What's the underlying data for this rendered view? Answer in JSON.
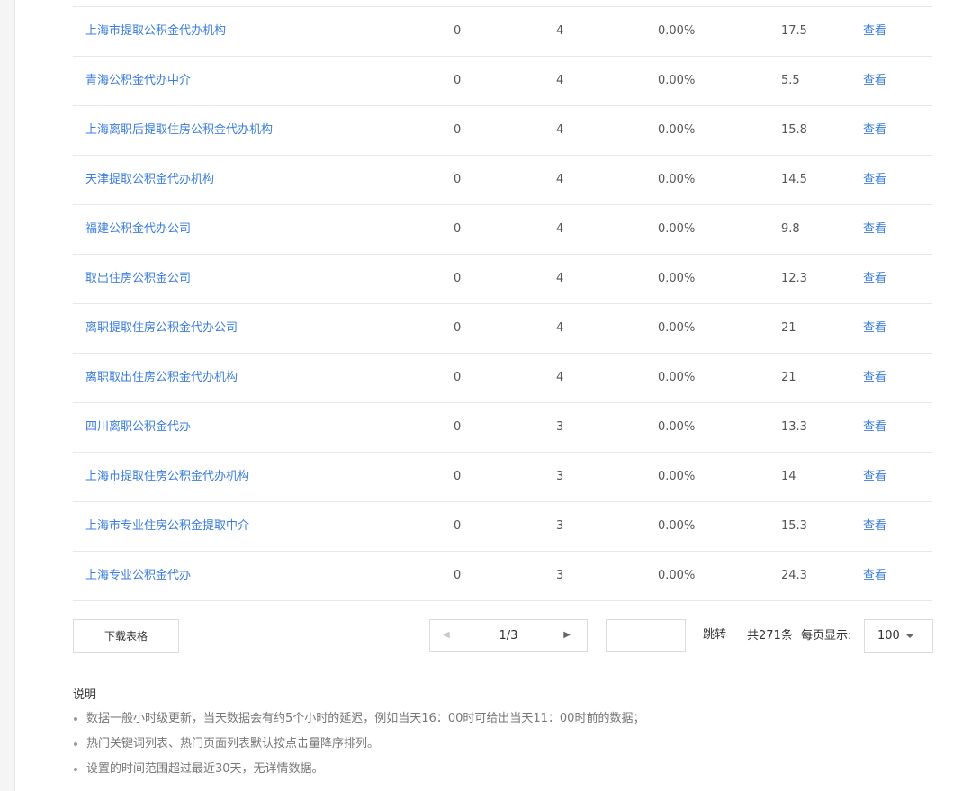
{
  "table": {
    "rows": [
      {
        "name": "上海市提取公积金代办机构",
        "a": "0",
        "b": "4",
        "c": "0.00%",
        "d": "17.5",
        "action": "查看"
      },
      {
        "name": "青海公积金代办中介",
        "a": "0",
        "b": "4",
        "c": "0.00%",
        "d": "5.5",
        "action": "查看"
      },
      {
        "name": "上海离职后提取住房公积金代办机构",
        "a": "0",
        "b": "4",
        "c": "0.00%",
        "d": "15.8",
        "action": "查看"
      },
      {
        "name": "天津提取公积金代办机构",
        "a": "0",
        "b": "4",
        "c": "0.00%",
        "d": "14.5",
        "action": "查看"
      },
      {
        "name": "福建公积金代办公司",
        "a": "0",
        "b": "4",
        "c": "0.00%",
        "d": "9.8",
        "action": "查看"
      },
      {
        "name": "取出住房公积金公司",
        "a": "0",
        "b": "4",
        "c": "0.00%",
        "d": "12.3",
        "action": "查看"
      },
      {
        "name": "离职提取住房公积金代办公司",
        "a": "0",
        "b": "4",
        "c": "0.00%",
        "d": "21",
        "action": "查看"
      },
      {
        "name": "离职取出住房公积金代办机构",
        "a": "0",
        "b": "4",
        "c": "0.00%",
        "d": "21",
        "action": "查看"
      },
      {
        "name": "四川离职公积金代办",
        "a": "0",
        "b": "3",
        "c": "0.00%",
        "d": "13.3",
        "action": "查看"
      },
      {
        "name": "上海市提取住房公积金代办机构",
        "a": "0",
        "b": "3",
        "c": "0.00%",
        "d": "14",
        "action": "查看"
      },
      {
        "name": "上海市专业住房公积金提取中介",
        "a": "0",
        "b": "3",
        "c": "0.00%",
        "d": "15.3",
        "action": "查看"
      },
      {
        "name": "上海专业公积金代办",
        "a": "0",
        "b": "3",
        "c": "0.00%",
        "d": "24.3",
        "action": "查看"
      }
    ]
  },
  "footer": {
    "download_label": "下载表格",
    "page_indicator": "1/3",
    "jump_input_value": "",
    "jump_label": "跳转",
    "total_label": "共271条",
    "per_page_label": "每页显示:",
    "per_page_value": "100"
  },
  "notes": {
    "title": "说明",
    "items": [
      "数据一般小时级更新，当天数据会有约5个小时的延迟，例如当天16：00时可给出当天11：00时前的数据；",
      "热门关键词列表、热门页面列表默认按点击量降序排列。",
      "设置的时间范围超过最近30天，无详情数据。"
    ]
  },
  "icons": {
    "prev": "chevron-left-icon",
    "next": "chevron-right-icon",
    "dropdown": "caret-down-icon"
  },
  "colors": {
    "link": "#3b7ddd",
    "border": "#e8e8e8"
  }
}
